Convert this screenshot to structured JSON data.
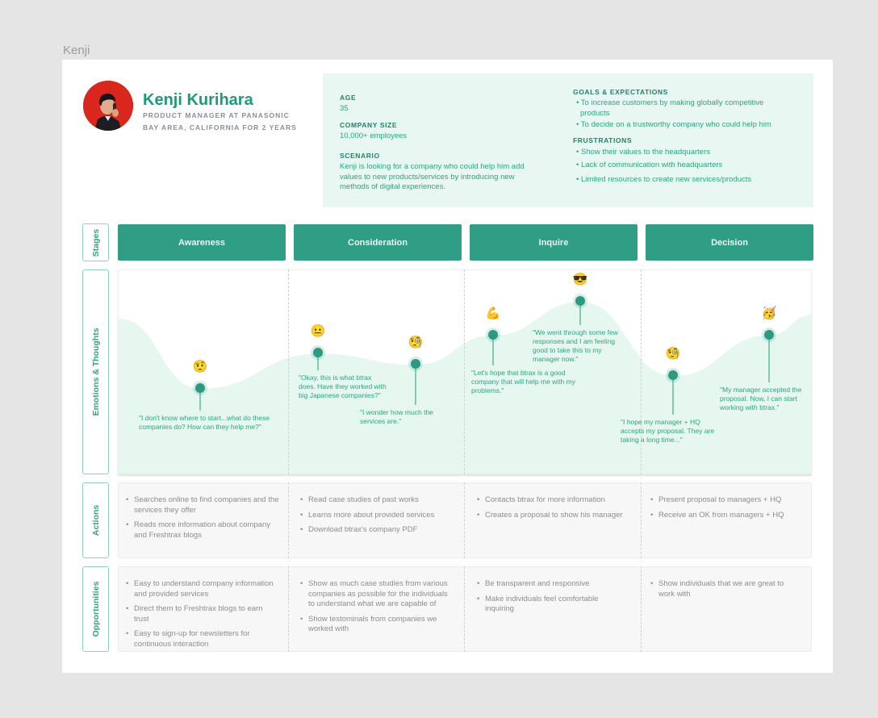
{
  "frame": {
    "label": "Kenji"
  },
  "persona": {
    "name": "Kenji Kurihara",
    "role": "PRODUCT MANAGER AT PANASONIC",
    "location": "BAY AREA, CALIFORNIA FOR 2 YEARS",
    "avatar_icon": "person-on-phone-photo"
  },
  "info": {
    "age_label": "AGE",
    "age": "35",
    "company_size_label": "COMPANY SIZE",
    "company_size": "10,000+ employees",
    "scenario_label": "SCENARIO",
    "scenario": "Kenji is looking for a company who could help him add values to new products/services by introducing new methods of digital experiences.",
    "goals_label": "GOALS & EXPECTATIONS",
    "goals": [
      "• To increase customers by making globally competitive products",
      "• To decide on a trustworthy company who could help him"
    ],
    "frustrations_label": "FRUSTRATIONS",
    "frustrations": [
      "• Show their values to the headquarters",
      "• Lack of communication with headquarters",
      "• Limited resources to create new services/products"
    ]
  },
  "rows": {
    "stages": "Stages",
    "emotions": "Emotions & Thoughts",
    "actions": "Actions",
    "opportunities": "Opportunities"
  },
  "stages": [
    "Awareness",
    "Consideration",
    "Inquire",
    "Decision"
  ],
  "emotions": [
    {
      "stage": "Awareness",
      "emoji": "🤨",
      "icon": "skeptical-face-icon",
      "level": 0.39,
      "quote": "\"I don't know where to start...what do these companies do? How can they help me?\""
    },
    {
      "stage": "Consideration",
      "emoji": "😐",
      "icon": "neutral-face-icon",
      "level": 0.58,
      "quote": "\"Okay, this is what btrax does. Have they worked with big Japanese companies?\""
    },
    {
      "stage": "Consideration",
      "emoji": "🧐",
      "icon": "monocle-face-icon",
      "level": 0.52,
      "quote": "\"I wonder how much the services are.\""
    },
    {
      "stage": "Inquire",
      "emoji": "💪",
      "icon": "flexed-biceps-icon",
      "level": 0.68,
      "quote": "\"Let's hope that btrax is a good company that will help me with my problems.\""
    },
    {
      "stage": "Inquire",
      "emoji": "😎",
      "icon": "sunglasses-face-icon",
      "level": 0.86,
      "quote": "\"We went through some few responses and I am feeling good to take this to my manager now.\""
    },
    {
      "stage": "Decision",
      "emoji": "🧐",
      "icon": "monocle-face-icon",
      "level": 0.46,
      "quote": "\"I hope my manager + HQ accepts my proposal. They are taking a long time...\""
    },
    {
      "stage": "Decision",
      "emoji": "🥳",
      "icon": "party-face-icon",
      "level": 0.68,
      "quote": "\"My manager accepted the proposal. Now, I can start working with btrax.\""
    }
  ],
  "actions": [
    [
      "Searches online to find companies and the services they offer",
      "Reads more information about company and Freshtrax blogs"
    ],
    [
      "Read case studies of past works",
      "Learns more about provided services",
      "Download btrax's company PDF"
    ],
    [
      "Contacts btrax for more information",
      "Creates a proposal to show his manager"
    ],
    [
      "Present proposal to managers + HQ",
      "Receive an OK from managers + HQ"
    ]
  ],
  "opportunities": [
    [
      "Easy to understand company information and provided services",
      "Direct them to Freshtrax blogs to earn trust",
      "Easy to sign-up for newsletters for continuous interaction"
    ],
    [
      "Show as much case studies from various companies as possible for the individuals to understand what we are capable of",
      "Show testominals from companies we worked with"
    ],
    [
      "Be transparent and responsive",
      "Make individuals feel comfortable inquiring"
    ],
    [
      "Show individuals that we are great to work with"
    ]
  ],
  "colors": {
    "accent": "#2f9e84",
    "accent_text": "#2aa582",
    "info_bg": "#e8f7f1",
    "curve_fill": "#e6f7f0",
    "avatar_bg": "#d9271e"
  }
}
